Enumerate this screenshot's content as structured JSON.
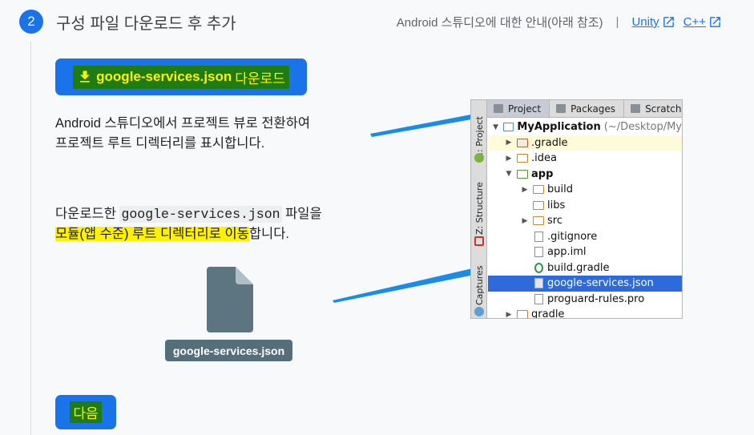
{
  "step": {
    "number": "2",
    "title": "구성 파일 다운로드 후 추가"
  },
  "help": {
    "text": "Android 스튜디오에 대한 안내(아래 참조)",
    "separator": "|",
    "links": [
      "Unity",
      "C++"
    ]
  },
  "download_button": {
    "filename": "google-services.json",
    "action": "다운로드"
  },
  "para1": {
    "line1": "Android 스튜디오에서 프로젝트 뷰로 전환하여",
    "line2": "프로젝트 루트 디렉터리를 표시합니다."
  },
  "para2": {
    "prefix": "다운로드한 ",
    "code": "google-services.json",
    "suffix": " 파일을",
    "highlight": "모듈(앱 수준) 루트 디렉터리로 이동",
    "end": "합니다."
  },
  "file_icon_label": "google-services.json",
  "ide": {
    "tabs": [
      "Project",
      "Packages",
      "Scratches"
    ],
    "side_labels": [
      "1: Project",
      "Z: Structure",
      "Captures"
    ],
    "project_name": "MyApplication",
    "project_path": "(~/Desktop/My",
    "tree": [
      ".gradle",
      ".idea",
      "app",
      "build",
      "libs",
      "src",
      ".gitignore",
      "app.iml",
      "build.gradle",
      "google-services.json",
      "proguard-rules.pro",
      "gradle"
    ]
  },
  "next_button": "다음",
  "colors": {
    "primary": "#1a73e8",
    "highlight": "#fff200",
    "highlight_dark": "#1e7c12",
    "arrow": "#1a8be8"
  }
}
